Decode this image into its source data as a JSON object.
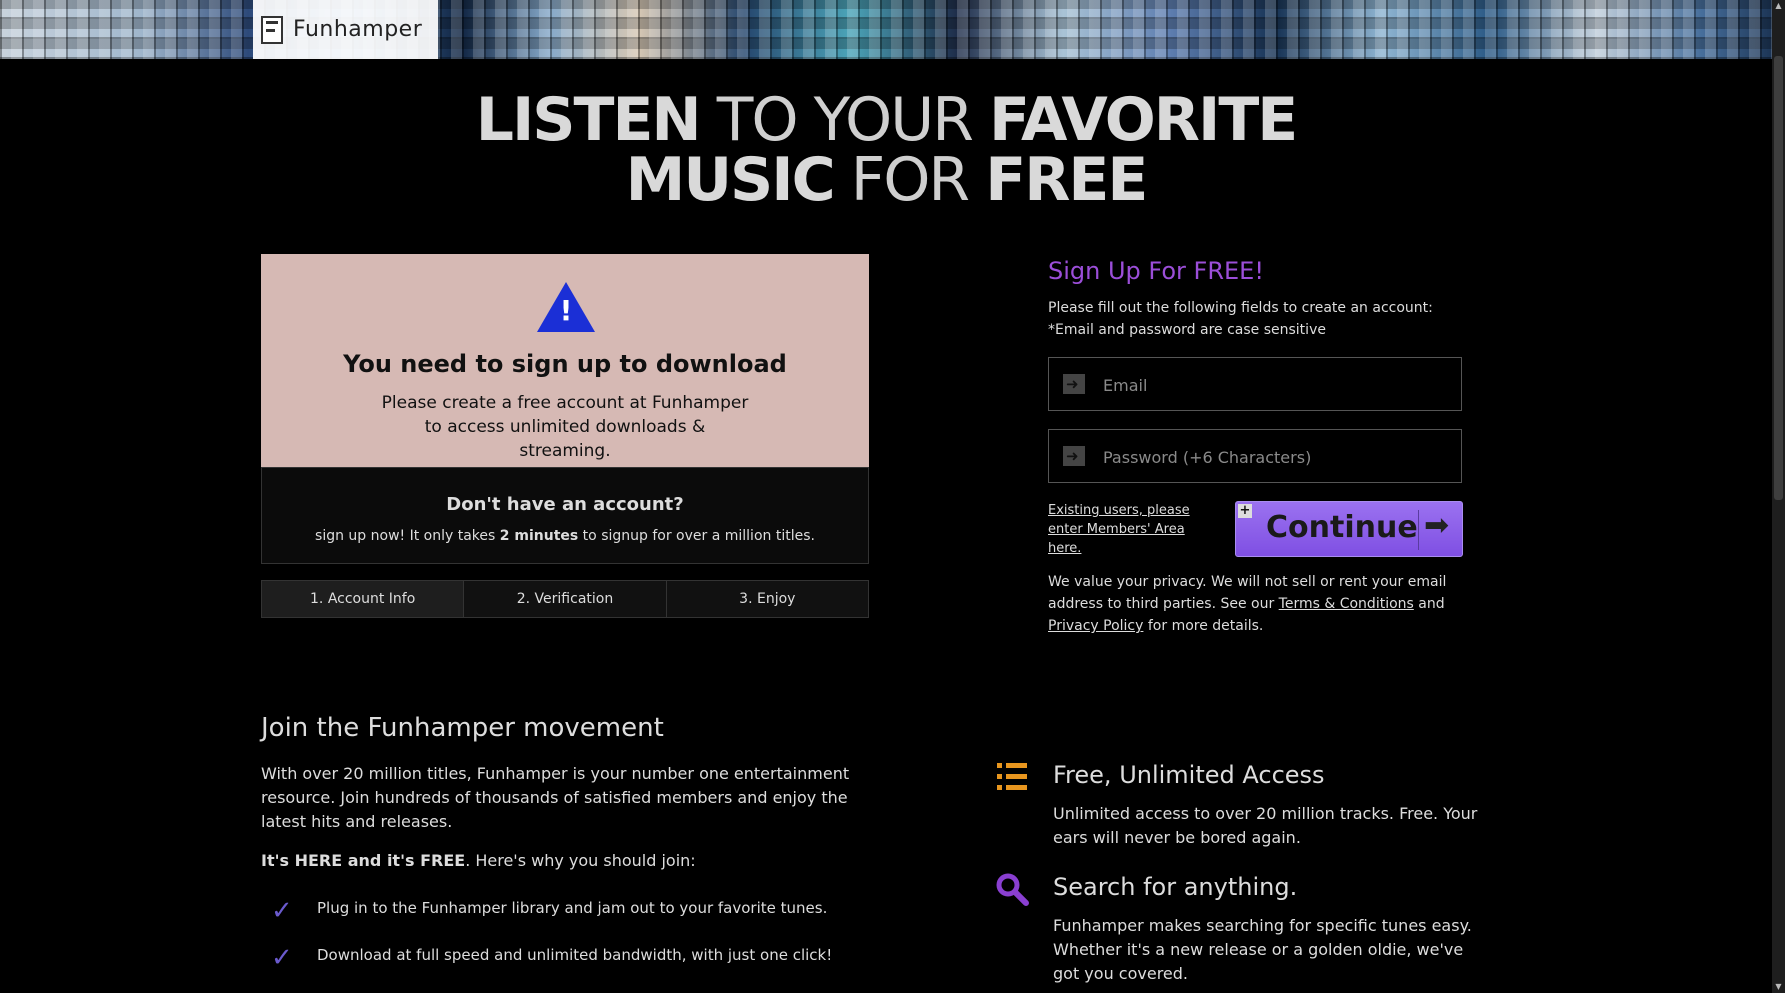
{
  "brand": {
    "name": "Funhamper"
  },
  "hero": {
    "line1": [
      {
        "text": "LISTEN",
        "bold": true
      },
      {
        "text": " TO YOUR ",
        "bold": false
      },
      {
        "text": "FAVORITE",
        "bold": true
      }
    ],
    "line2": [
      {
        "text": "MUSIC",
        "bold": true
      },
      {
        "text": " FOR ",
        "bold": false
      },
      {
        "text": "FREE",
        "bold": true
      }
    ]
  },
  "alert": {
    "icon": "warning-triangle-icon",
    "icon_color": "#1b2fd6",
    "title": "You need to sign up to download",
    "body": "Please create a free account at Funhamper to access unlimited downloads & streaming."
  },
  "account": {
    "title": "Don't have an account?",
    "text_before": "sign up now! It only takes ",
    "text_bold": "2 minutes",
    "text_after": " to signup for over a million titles."
  },
  "steps": [
    "1. Account Info",
    "2. Verification",
    "3. Enjoy"
  ],
  "signup": {
    "title": "Sign Up For FREE!",
    "title_color": "#9b4ed8",
    "desc_line1": "Please fill out the following fields to create an account:",
    "desc_line2": "*Email and password are case sensitive",
    "email_placeholder": "Email",
    "password_placeholder": "Password (+6 Characters)",
    "existing_link": "Existing users, please enter Members' Area here.",
    "continue_label": "Continue",
    "privacy_before": "We value your privacy. We will not sell or rent your email address to third parties. See our ",
    "terms_link": "Terms & Conditions",
    "privacy_mid": " and ",
    "privacy_link": "Privacy Policy",
    "privacy_after": " for more details."
  },
  "movement": {
    "title": "Join the Funhamper movement",
    "body": "With over 20 million titles, Funhamper is your number one entertainment resource. Join hundreds of thousands of satisfied members and enjoy the latest hits and releases.",
    "why_bold": "It's HERE and it's FREE",
    "why_rest": ". Here's why you should join:",
    "bullets": [
      "Plug in to the Funhamper library and jam out to your favorite tunes.",
      "Download at full speed and unlimited bandwidth, with just one click!"
    ]
  },
  "features": [
    {
      "icon": "list-icon",
      "icon_color": "#e8961e",
      "title": "Free, Unlimited Access",
      "body": "Unlimited access to over 20 million tracks. Free. Your ears will never be bored again."
    },
    {
      "icon": "search-icon",
      "icon_color": "#8a3fd1",
      "title": "Search for anything.",
      "body": "Funhamper makes searching for specific tunes easy. Whether it's a new release or a golden oldie, we've got you covered."
    }
  ]
}
